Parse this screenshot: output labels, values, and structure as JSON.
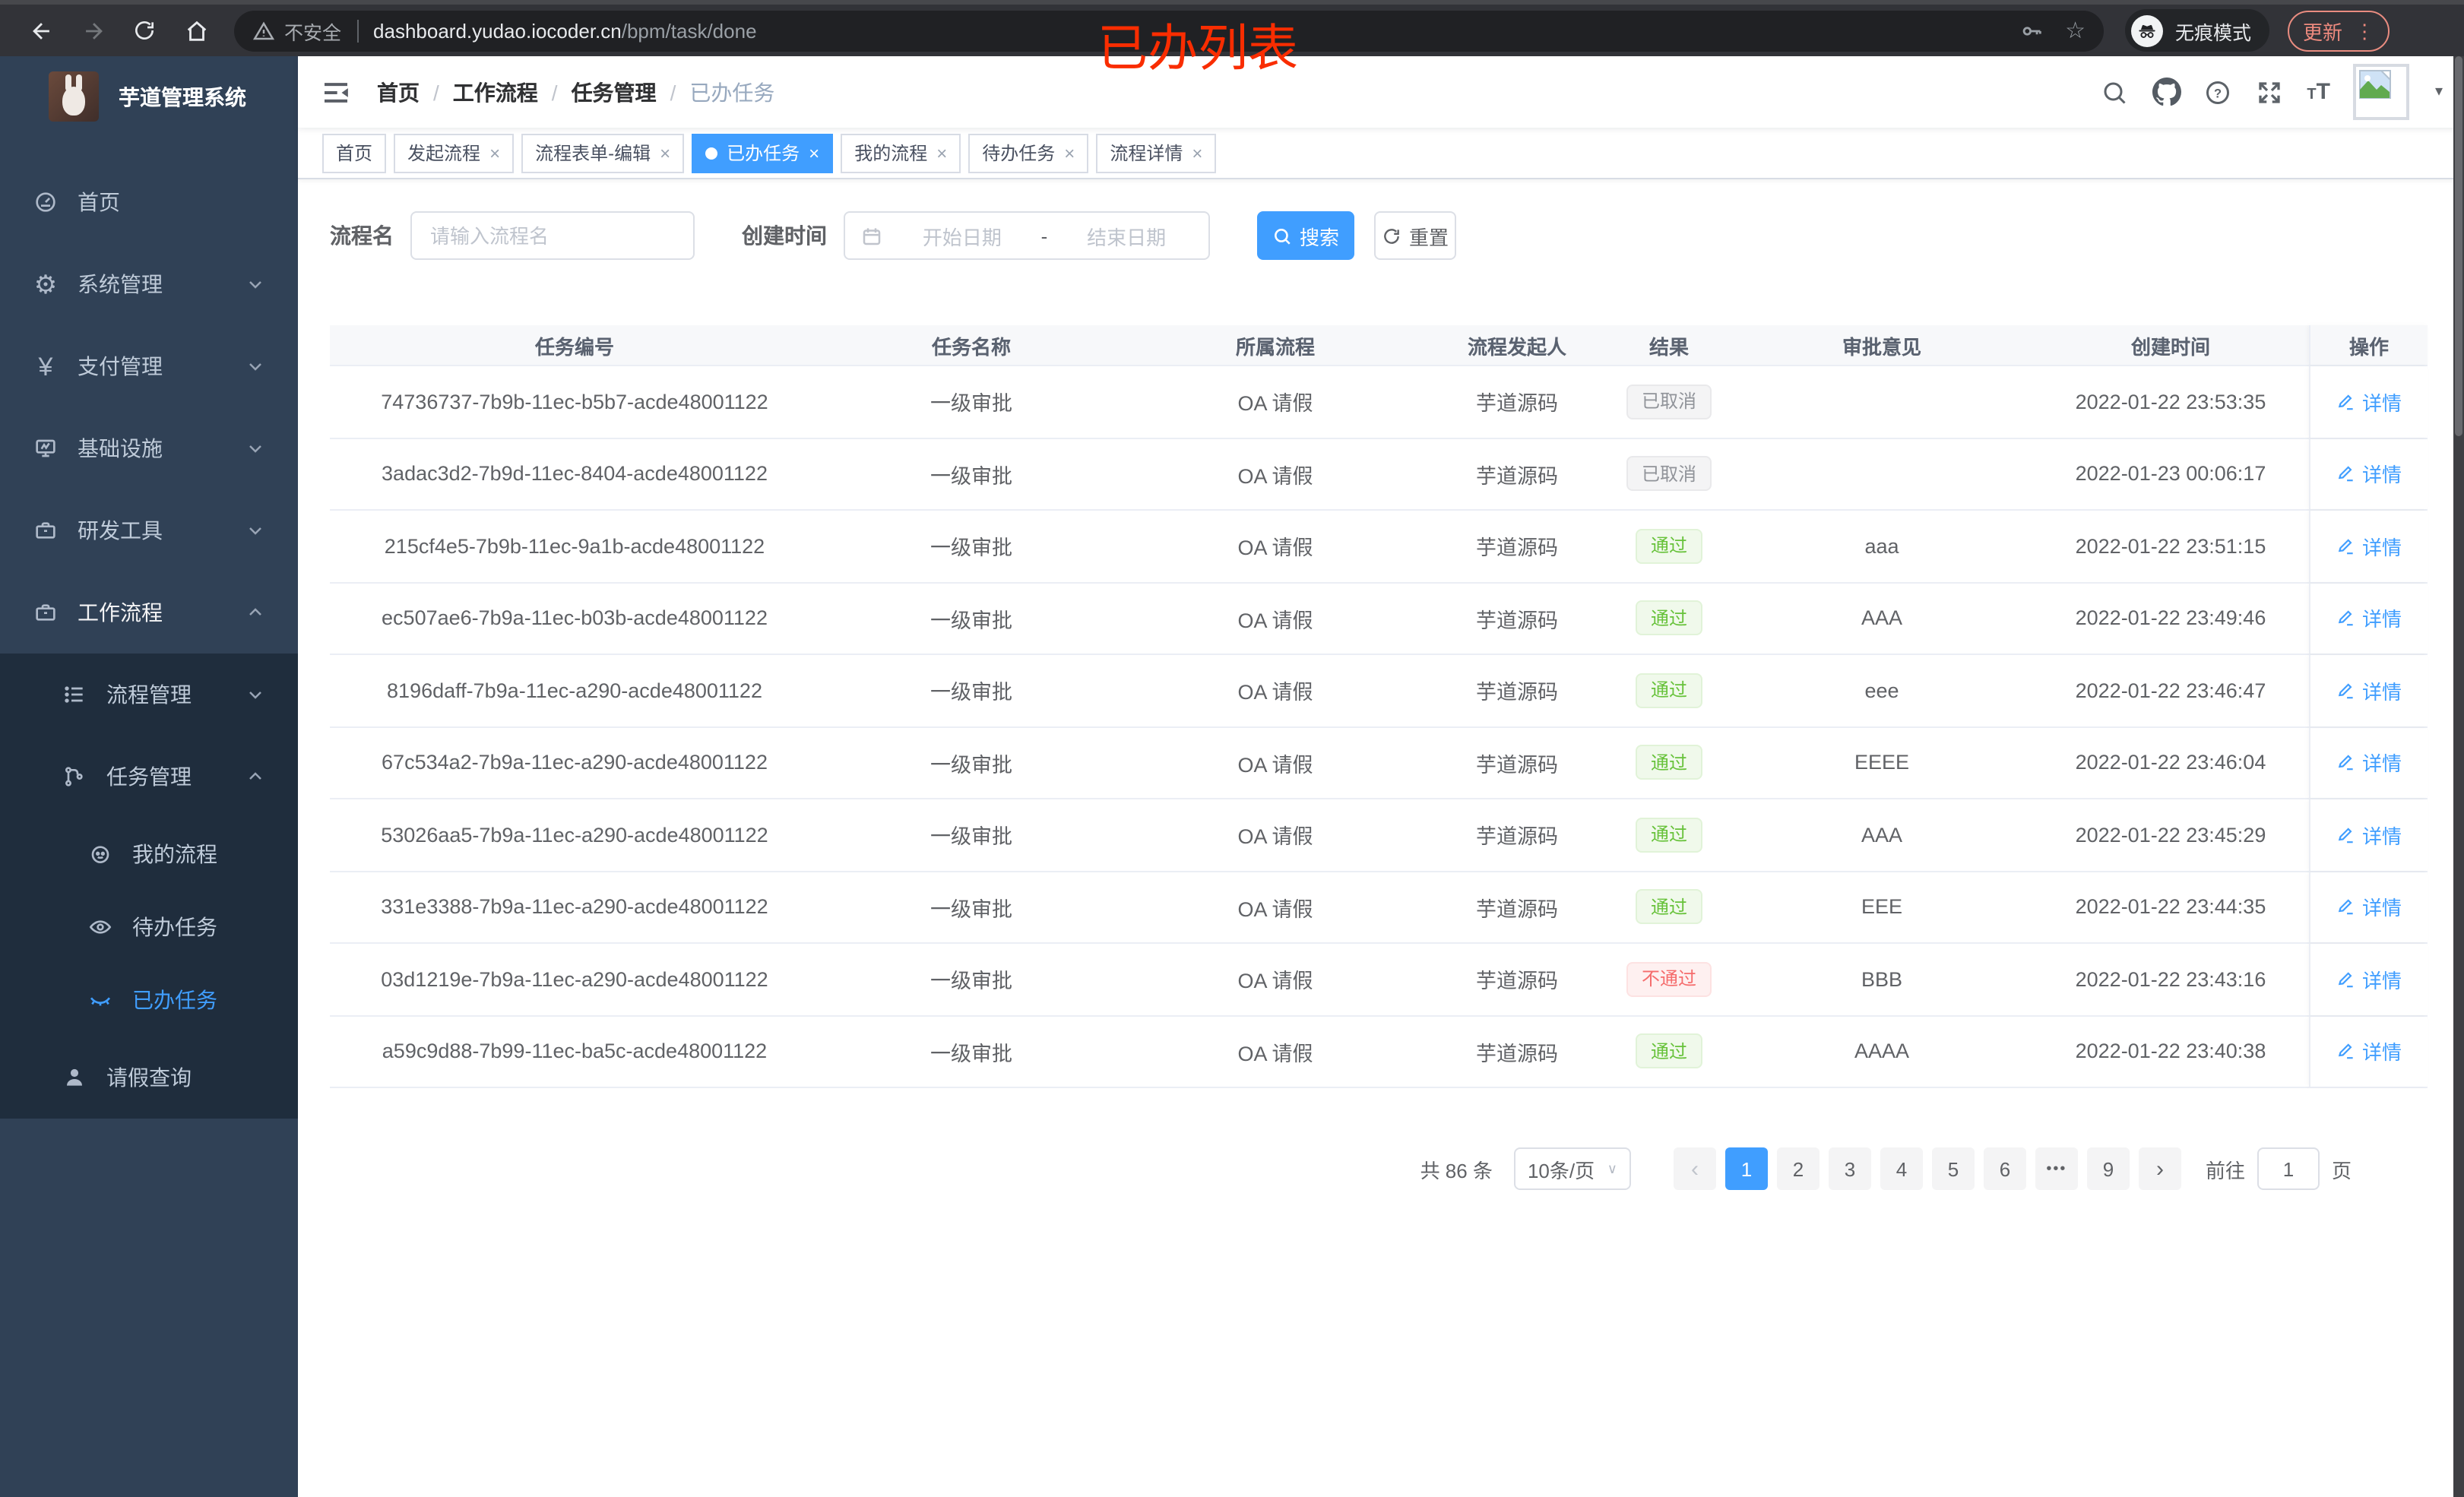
{
  "browser": {
    "security_label": "不安全",
    "url_host": "dashboard.yudao.iocoder.cn",
    "url_path": "/bpm/task/done",
    "incognito_label": "无痕模式",
    "update_label": "更新",
    "overlay_title": "已办列表"
  },
  "icons": {
    "star": "☆",
    "gear": "⚙",
    "yen": "¥",
    "close": "×",
    "prev": "‹",
    "next": "›",
    "caret_down": "▾",
    "dots_vertical": "⋮",
    "ellipsis": "•••"
  },
  "sidebar": {
    "title": "芋道管理系统",
    "menu": [
      {
        "label": "首页"
      },
      {
        "label": "系统管理"
      },
      {
        "label": "支付管理"
      },
      {
        "label": "基础设施"
      },
      {
        "label": "研发工具"
      },
      {
        "label": "工作流程"
      }
    ],
    "submenu": {
      "process_mgmt": "流程管理",
      "task_mgmt": "任务管理",
      "my_process": "我的流程",
      "todo_tasks": "待办任务",
      "done_tasks": "已办任务",
      "leave_query": "请假查询"
    }
  },
  "breadcrumb": {
    "separator": "/",
    "items": [
      "首页",
      "工作流程",
      "任务管理",
      "已办任务"
    ]
  },
  "tabs": [
    {
      "label": "首页"
    },
    {
      "label": "发起流程"
    },
    {
      "label": "流程表单-编辑"
    },
    {
      "label": "已办任务"
    },
    {
      "label": "我的流程"
    },
    {
      "label": "待办任务"
    },
    {
      "label": "流程详情"
    }
  ],
  "filters": {
    "process_name_label": "流程名",
    "process_name_placeholder": "请输入流程名",
    "create_time_label": "创建时间",
    "start_date_placeholder": "开始日期",
    "range_separator": "-",
    "end_date_placeholder": "结束日期",
    "search_label": "搜索",
    "reset_label": "重置"
  },
  "table": {
    "columns": [
      "任务编号",
      "任务名称",
      "所属流程",
      "流程发起人",
      "结果",
      "审批意见",
      "创建时间",
      "操作"
    ],
    "detail_label": "详情",
    "rows": [
      {
        "id": "74736737-7b9b-11ec-b5b7-acde48001122",
        "name": "一级审批",
        "process": "OA 请假",
        "starter": "芋道源码",
        "result": "已取消",
        "result_type": "info",
        "comment": "",
        "created": "2022-01-22 23:53:35"
      },
      {
        "id": "3adac3d2-7b9d-11ec-8404-acde48001122",
        "name": "一级审批",
        "process": "OA 请假",
        "starter": "芋道源码",
        "result": "已取消",
        "result_type": "info",
        "comment": "",
        "created": "2022-01-23 00:06:17"
      },
      {
        "id": "215cf4e5-7b9b-11ec-9a1b-acde48001122",
        "name": "一级审批",
        "process": "OA 请假",
        "starter": "芋道源码",
        "result": "通过",
        "result_type": "success",
        "comment": "aaa",
        "created": "2022-01-22 23:51:15"
      },
      {
        "id": "ec507ae6-7b9a-11ec-b03b-acde48001122",
        "name": "一级审批",
        "process": "OA 请假",
        "starter": "芋道源码",
        "result": "通过",
        "result_type": "success",
        "comment": "AAA",
        "created": "2022-01-22 23:49:46"
      },
      {
        "id": "8196daff-7b9a-11ec-a290-acde48001122",
        "name": "一级审批",
        "process": "OA 请假",
        "starter": "芋道源码",
        "result": "通过",
        "result_type": "success",
        "comment": "eee",
        "created": "2022-01-22 23:46:47"
      },
      {
        "id": "67c534a2-7b9a-11ec-a290-acde48001122",
        "name": "一级审批",
        "process": "OA 请假",
        "starter": "芋道源码",
        "result": "通过",
        "result_type": "success",
        "comment": "EEEE",
        "created": "2022-01-22 23:46:04"
      },
      {
        "id": "53026aa5-7b9a-11ec-a290-acde48001122",
        "name": "一级审批",
        "process": "OA 请假",
        "starter": "芋道源码",
        "result": "通过",
        "result_type": "success",
        "comment": "AAA",
        "created": "2022-01-22 23:45:29"
      },
      {
        "id": "331e3388-7b9a-11ec-a290-acde48001122",
        "name": "一级审批",
        "process": "OA 请假",
        "starter": "芋道源码",
        "result": "通过",
        "result_type": "success",
        "comment": "EEE",
        "created": "2022-01-22 23:44:35"
      },
      {
        "id": "03d1219e-7b9a-11ec-a290-acde48001122",
        "name": "一级审批",
        "process": "OA 请假",
        "starter": "芋道源码",
        "result": "不通过",
        "result_type": "danger",
        "comment": "BBB",
        "created": "2022-01-22 23:43:16"
      },
      {
        "id": "a59c9d88-7b99-11ec-ba5c-acde48001122",
        "name": "一级审批",
        "process": "OA 请假",
        "starter": "芋道源码",
        "result": "通过",
        "result_type": "success",
        "comment": "AAAA",
        "created": "2022-01-22 23:40:38"
      }
    ]
  },
  "pagination": {
    "total_label": "共 86 条",
    "page_size_label": "10条/页",
    "pages": [
      "1",
      "2",
      "3",
      "4",
      "5",
      "6",
      "9"
    ],
    "active_page": "1",
    "goto_label": "前往",
    "goto_value": "1",
    "page_unit_label": "页"
  },
  "colors": {
    "accent": "#409eff",
    "success": "#67c23a",
    "danger": "#f56c6c",
    "info": "#909399",
    "sidebar_bg": "#304156",
    "submenu_bg": "#1f2d3d",
    "overlay_red": "#f92d01"
  }
}
